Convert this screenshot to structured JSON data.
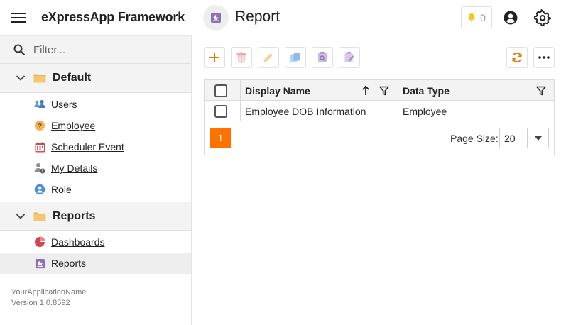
{
  "header": {
    "app_title": "eXpressApp Framework",
    "view_title": "Report",
    "notification_count": "0"
  },
  "sidebar": {
    "filter_placeholder": "Filter...",
    "groups": [
      {
        "label": "Default",
        "items": [
          {
            "label": "Users",
            "icon": "users-icon"
          },
          {
            "label": "Employee",
            "icon": "employee-icon"
          },
          {
            "label": "Scheduler Event",
            "icon": "calendar-icon"
          },
          {
            "label": "My Details",
            "icon": "my-details-icon"
          },
          {
            "label": "Role",
            "icon": "role-icon"
          }
        ]
      },
      {
        "label": "Reports",
        "items": [
          {
            "label": "Dashboards",
            "icon": "dashboard-icon"
          },
          {
            "label": "Reports",
            "icon": "report-icon",
            "selected": true
          }
        ]
      }
    ],
    "footer": {
      "app_name": "YourApplicationName",
      "version": "Version 1.0.8592"
    }
  },
  "toolbar": {
    "buttons": [
      "new",
      "delete",
      "edit",
      "clone",
      "preview",
      "design"
    ],
    "right_buttons": [
      "refresh",
      "more"
    ],
    "accent_color": "#e07b00"
  },
  "grid": {
    "columns": [
      {
        "label": "Display Name",
        "sort": "ascending",
        "filter": true
      },
      {
        "label": "Data Type",
        "filter": true
      }
    ],
    "rows": [
      {
        "display_name": "Employee DOB Information",
        "data_type": "Employee"
      }
    ],
    "pager": {
      "current_page": "1",
      "page_size_label": "Page Size:",
      "page_size": "20"
    }
  },
  "colors": {
    "accent": "#ff7200",
    "report_icon": "#8e6fb5",
    "folder": "#f0b35a"
  }
}
